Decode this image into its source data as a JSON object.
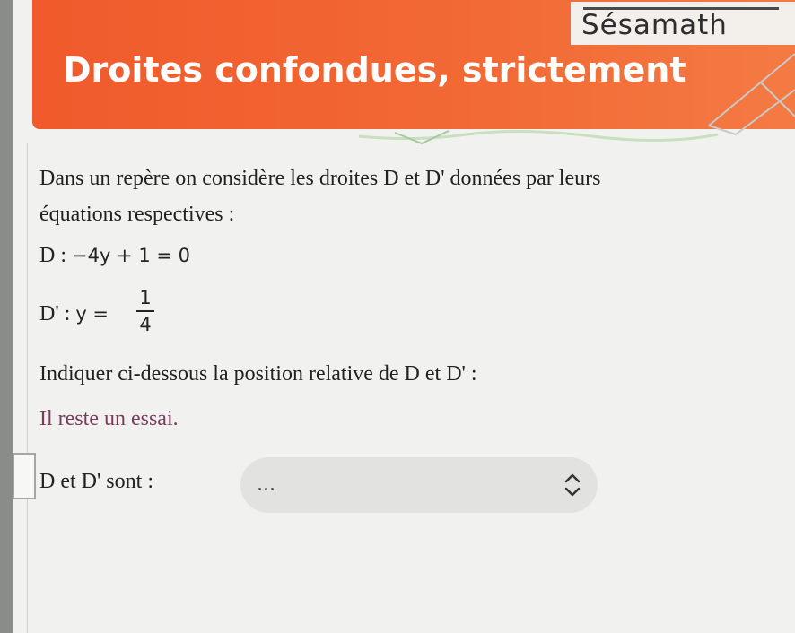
{
  "brand": {
    "name": "Sésamath"
  },
  "header": {
    "title": "Droites confondues, strictement"
  },
  "exercise": {
    "intro_line1": "Dans un repère on considère les droites D et D' données par leurs",
    "intro_line2": "équations respectives :",
    "eq1_label": "D : ",
    "eq1_math": "−4y + 1 = 0",
    "eq2_label": "D' : ",
    "eq2_math_lhs": "y =",
    "eq2_frac_num": "1",
    "eq2_frac_den": "4",
    "instruction": "Indiquer ci-dessous la position relative de D et D' :",
    "remaining": "Il reste un essai.",
    "answer_label": "D et D' sont : "
  },
  "answer_select": {
    "value": "..."
  },
  "colors": {
    "header": "#f05a2c",
    "remaining_text": "#7a3a5c"
  }
}
